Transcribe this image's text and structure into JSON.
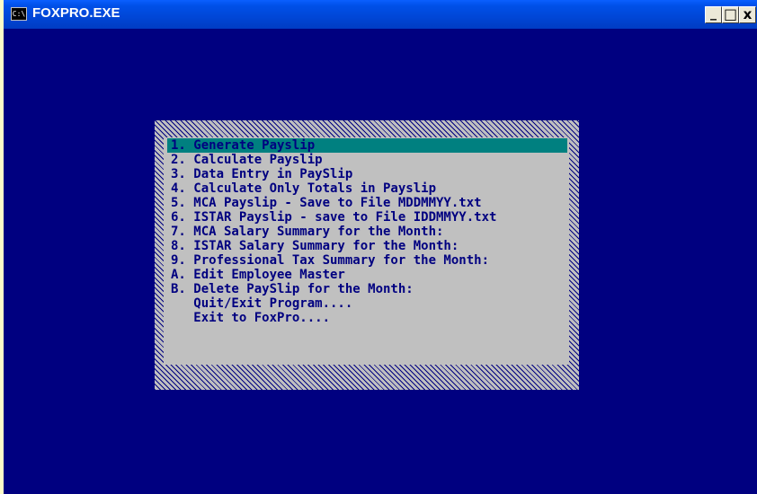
{
  "window": {
    "title": "FOXPRO.EXE",
    "icon_label": "C:\\",
    "controls": {
      "minimize": "_",
      "maximize": "□",
      "close": "x"
    }
  },
  "menu": {
    "items": [
      {
        "label": "1. Generate Payslip",
        "selected": true
      },
      {
        "label": "2. Calculate Payslip",
        "selected": false
      },
      {
        "label": "3. Data Entry in PaySlip",
        "selected": false
      },
      {
        "label": "4. Calculate Only Totals in Payslip",
        "selected": false
      },
      {
        "label": "5. MCA Payslip - Save to File MDDMMYY.txt",
        "selected": false
      },
      {
        "label": "6. ISTAR Payslip - save to File IDDMMYY.txt",
        "selected": false
      },
      {
        "label": "7. MCA Salary Summary for the Month:",
        "selected": false
      },
      {
        "label": "8. ISTAR Salary Summary for the Month:",
        "selected": false
      },
      {
        "label": "9. Professional Tax Summary for the Month:",
        "selected": false
      },
      {
        "label": "A. Edit Employee Master",
        "selected": false
      },
      {
        "label": "B. Delete PaySlip for the Month:",
        "selected": false
      },
      {
        "label": "   Quit/Exit Program....",
        "selected": false
      },
      {
        "label": "   Exit to FoxPro....",
        "selected": false
      }
    ]
  },
  "colors": {
    "screen_background": "#000080",
    "menu_background": "#c0c0c0",
    "highlight": "#008080",
    "menu_text": "#000080"
  }
}
